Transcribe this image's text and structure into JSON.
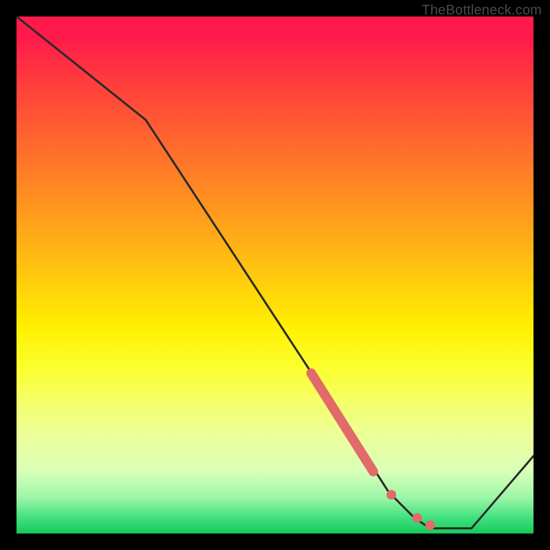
{
  "watermark": "TheBottleneck.com",
  "colors": {
    "frame": "#000000",
    "curve_stroke": "#2a2a2a",
    "marker_fill": "#e26a6a",
    "marker_stroke": "#e26a6a"
  },
  "chart_data": {
    "type": "line",
    "title": "",
    "xlabel": "",
    "ylabel": "",
    "xlim": [
      0,
      100
    ],
    "ylim": [
      0,
      100
    ],
    "x": [
      0,
      25,
      63,
      72,
      74,
      77,
      80,
      88,
      100
    ],
    "y": [
      100,
      80,
      22,
      8,
      6,
      3,
      1,
      1,
      15
    ],
    "series": [
      {
        "name": "bottleneck-curve",
        "x": [
          0,
          25,
          63,
          72,
          74,
          77,
          80,
          88,
          100
        ],
        "y": [
          100,
          80,
          22,
          8,
          6,
          3,
          1,
          1,
          15
        ]
      }
    ],
    "highlight_segment": {
      "x0": 57,
      "y0": 31,
      "x1": 69,
      "y1": 12
    },
    "markers": [
      {
        "x": 72.5,
        "y": 7.5
      },
      {
        "x": 77.5,
        "y": 3
      },
      {
        "x": 80,
        "y": 1.6
      }
    ]
  }
}
